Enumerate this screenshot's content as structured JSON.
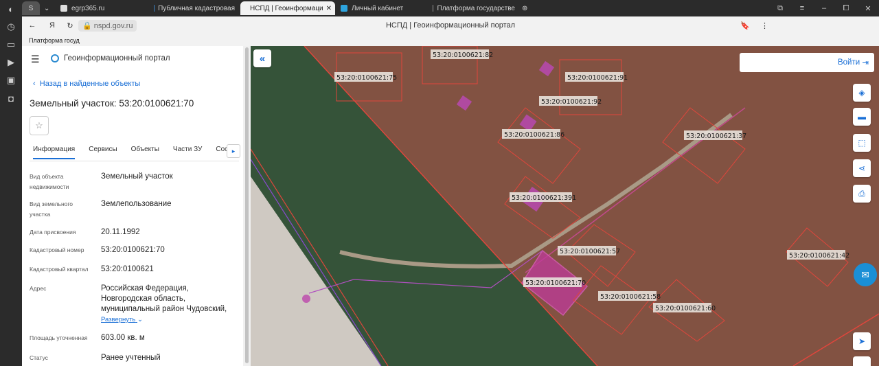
{
  "browser": {
    "tabs": [
      {
        "label": "egrp365.ru",
        "active": false
      },
      {
        "label": "Публичная кадастровая",
        "active": false
      },
      {
        "label": "НСПД | Геоинформаци",
        "active": true
      },
      {
        "label": "Личный кабинет",
        "active": false
      },
      {
        "label": "Платформа государстве",
        "active": false
      }
    ],
    "url": "nspd.gov.ru",
    "page_title": "НСПД | Геоинформационный портал",
    "bookmark": "Платформа госуд"
  },
  "sidebar": {
    "app_title": "Геоинформационный портал",
    "back_link": "Назад в найденные объекты",
    "object_title": "Земельный участок: 53:20:0100621:70",
    "tabs": [
      "Информация",
      "Сервисы",
      "Объекты",
      "Части ЗУ",
      "Соста"
    ],
    "fields": [
      {
        "label": "Вид объекта недвижимости",
        "value": "Земельный участок"
      },
      {
        "label": "Вид земельного участка",
        "value": "Землепользование"
      },
      {
        "label": "Дата присвоения",
        "value": "20.11.1992"
      },
      {
        "label": "Кадастровый номер",
        "value": "53:20:0100621:70"
      },
      {
        "label": "Кадастровый квартал",
        "value": "53:20:0100621"
      },
      {
        "label": "Адрес",
        "value": "Российская Федерация, Новгородская область, муниципальный район Чудовский,"
      },
      {
        "label": "Площадь уточненная",
        "value": "603.00 кв. м"
      },
      {
        "label": "Статус",
        "value": "Ранее учтенный"
      }
    ],
    "expand_link": "Развернуть"
  },
  "map": {
    "login_label": "Войти",
    "parcels": [
      "53:20:0100621:82",
      "53:20:0100621:75",
      "53:20:0100621:91",
      "53:20:0100621:92",
      "53:20:0100621:86",
      "53:20:0100621:37",
      "53:20:0100621:391",
      "53:20:0100621:57",
      "53:20:0100621:70",
      "53:20:0100621:58",
      "53:20:0100621:60",
      "53:20:0100621:42"
    ]
  }
}
